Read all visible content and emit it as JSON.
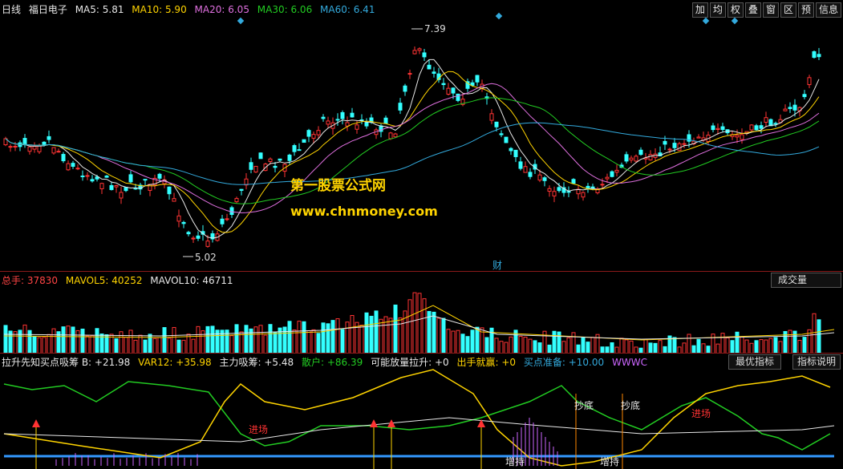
{
  "kline": {
    "period": "日线",
    "stock": "福日电子",
    "ma": [
      {
        "label": "MA5: 5.81",
        "color": "#e8e8e8"
      },
      {
        "label": "MA10: 5.90",
        "color": "#ffd400"
      },
      {
        "label": "MA20: 6.05",
        "color": "#e070e0"
      },
      {
        "label": "MA30: 6.06",
        "color": "#22cc22"
      },
      {
        "label": "MA60: 6.41",
        "color": "#33aadd"
      }
    ],
    "toolbar": [
      "加",
      "均",
      "权",
      "叠",
      "窗",
      "区",
      "预",
      "信息"
    ],
    "high_label": "7.39",
    "low_label": "5.02",
    "fin_marker": "财",
    "colors": {
      "up": "#ff3333",
      "down": "#33ffff"
    }
  },
  "watermark": {
    "line1": "第一股票公式网",
    "line2": "www.chnmoney.com"
  },
  "volume": {
    "items": [
      {
        "label": "总手: 37830",
        "color": "#ff4444"
      },
      {
        "label": "MAVOL5: 40252",
        "color": "#ffd400"
      },
      {
        "label": "MAVOL10: 46711",
        "color": "#e8e8e8"
      }
    ],
    "dropdown": "成交量"
  },
  "indicator": {
    "items": [
      {
        "label": "拉升先知买点吸筹 B: +21.98",
        "color": "#e8e8e8"
      },
      {
        "label": "VAR12: +35.98",
        "color": "#ffd400"
      },
      {
        "label": "主力吸筹: +5.48",
        "color": "#e8e8e8"
      },
      {
        "label": "散户: +86.39",
        "color": "#22cc22"
      },
      {
        "label": "可能放量拉升: +0",
        "color": "#e8e8e8"
      },
      {
        "label": "出手就赢: +0",
        "color": "#ffd400"
      },
      {
        "label": "买点准备: +10.00",
        "color": "#33aadd"
      },
      {
        "label": "WWWC",
        "color": "#cc66ff"
      }
    ],
    "btn_best": "最优指标",
    "btn_help": "指标说明",
    "annotations": {
      "enter": "进场",
      "bottom": "抄底",
      "add": "增持"
    }
  }
}
